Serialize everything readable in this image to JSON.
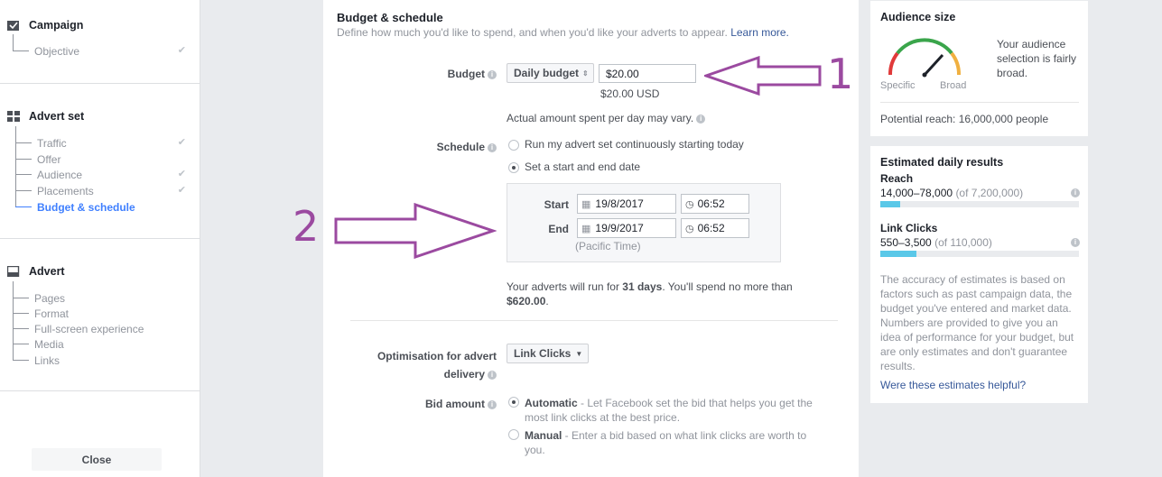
{
  "sidebar": {
    "campaign": {
      "title": "Campaign",
      "items": [
        {
          "label": "Objective",
          "checked": true
        }
      ]
    },
    "advert_set": {
      "title": "Advert set",
      "items": [
        {
          "label": "Traffic",
          "checked": true
        },
        {
          "label": "Offer",
          "checked": false
        },
        {
          "label": "Audience",
          "checked": true
        },
        {
          "label": "Placements",
          "checked": true
        },
        {
          "label": "Budget & schedule",
          "checked": false,
          "active": true
        }
      ]
    },
    "advert": {
      "title": "Advert",
      "items": [
        {
          "label": "Pages"
        },
        {
          "label": "Format"
        },
        {
          "label": "Full-screen experience"
        },
        {
          "label": "Media"
        },
        {
          "label": "Links"
        }
      ]
    },
    "close_label": "Close"
  },
  "main": {
    "title": "Budget & schedule",
    "subtitle": "Define how much you'd like to spend, and when you'd like your adverts to appear.",
    "learn_more": "Learn more.",
    "budget": {
      "label": "Budget",
      "type": "Daily budget",
      "value": "$20.00",
      "converted": "$20.00 USD",
      "note": "Actual amount spent per day may vary."
    },
    "schedule": {
      "label": "Schedule",
      "option_continuous": "Run my advert set continuously starting today",
      "option_dates": "Set a start and end date",
      "selected": "dates",
      "start_label": "Start",
      "start_date": "19/8/2017",
      "start_time": "06:52",
      "end_label": "End",
      "end_date": "19/9/2017",
      "end_time": "06:52",
      "timezone": "(Pacific Time)",
      "summary_prefix": "Your adverts will run for ",
      "summary_days": "31 days",
      "summary_mid": ". You'll spend no more than",
      "summary_amount": "$620.00",
      "summary_suffix": "."
    },
    "optimisation": {
      "label_line1": "Optimisation for advert",
      "label_line2": "delivery",
      "value": "Link Clicks"
    },
    "bid": {
      "label": "Bid amount",
      "automatic_title": "Automatic",
      "automatic_desc_line1": " - Let Facebook set the bid that helps you get the",
      "automatic_desc_line2": "most link clicks at the best price.",
      "manual_title": "Manual",
      "manual_desc_line1": " - Enter a bid based on what link clicks are worth to",
      "manual_desc_line2": "you.",
      "selected": "automatic"
    }
  },
  "audience": {
    "title": "Audience size",
    "gauge_specific": "Specific",
    "gauge_broad": "Broad",
    "description_line1": "Your audience",
    "description_line2": "selection is fairly",
    "description_line3": "broad.",
    "potential_reach": "Potential reach: 16,000,000 people"
  },
  "estimates": {
    "title": "Estimated daily results",
    "reach_label": "Reach",
    "reach_range": "14,000–78,000",
    "reach_total": "(of 7,200,000)",
    "reach_fraction": 0.1,
    "clicks_label": "Link Clicks",
    "clicks_range": "550–3,500",
    "clicks_total": "(of 110,000)",
    "clicks_fraction": 0.18,
    "disclaimer": [
      "The accuracy of estimates is based on",
      "factors such as past campaign data, the",
      "budget you've entered and market data.",
      "Numbers are provided to give you an",
      "idea of performance for your budget, but",
      "are only estimates and don't guarantee",
      "results."
    ],
    "helpful_link": "Were these estimates helpful?"
  },
  "annotations": {
    "one": "1",
    "two": "2"
  },
  "colors": {
    "accent_purple": "#9b4aa0",
    "link_blue": "#365899",
    "bar_blue": "#5ac8e8"
  }
}
